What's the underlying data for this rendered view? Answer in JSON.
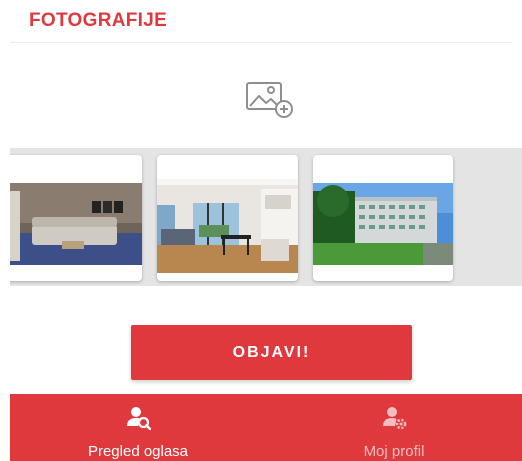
{
  "photos_section": {
    "title": "FOTOGRAFIJE",
    "add_photo_icon": "add-photo-icon"
  },
  "gallery": {
    "photos": [
      {
        "subject": "living-room",
        "icon": "photo-thumbnail"
      },
      {
        "subject": "open-plan-living-kitchen",
        "icon": "photo-thumbnail"
      },
      {
        "subject": "apartment-building",
        "icon": "photo-thumbnail"
      }
    ]
  },
  "actions": {
    "publish_label": "OBJAVI!"
  },
  "bottom_nav": {
    "items": [
      {
        "label": "Pregled oglasa",
        "icon": "user-search-icon",
        "active": true
      },
      {
        "label": "Moj profil",
        "icon": "user-settings-icon",
        "active": false
      }
    ]
  },
  "colors": {
    "accent": "#e0393d",
    "gallery_background": "#e4e4e4",
    "nav_inactive_text": "#f4bcbe"
  }
}
